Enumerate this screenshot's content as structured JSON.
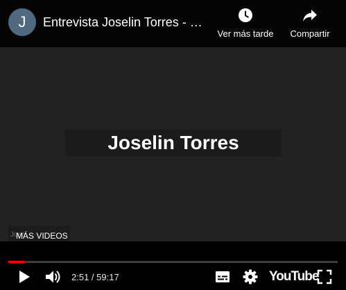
{
  "channel": {
    "avatar_letter": "J"
  },
  "video": {
    "title": "Entrevista Joselin Torres - Sociedad y Cultura"
  },
  "actions": {
    "watch_later_label": "Ver más tarde",
    "share_label": "Compartir"
  },
  "frame": {
    "name_plate": "Joselin Torres",
    "more_videos_label": "MÁS VIDEOS",
    "more_videos_ghost": "Jose"
  },
  "controls": {
    "time_current": "2:51",
    "time_separator": " / ",
    "time_total": "59:17",
    "progress_fraction": 0.048,
    "youtube_label": "YouTube"
  },
  "colors": {
    "progress_played": "#ff0000",
    "avatar_bg": "#4f6a80"
  },
  "icons": {
    "watch_later": "clock-icon",
    "share": "share-arrow-icon",
    "play": "play-icon",
    "volume": "volume-icon",
    "subtitles": "subtitles-icon",
    "settings": "gear-icon",
    "fullscreen": "fullscreen-icon"
  }
}
